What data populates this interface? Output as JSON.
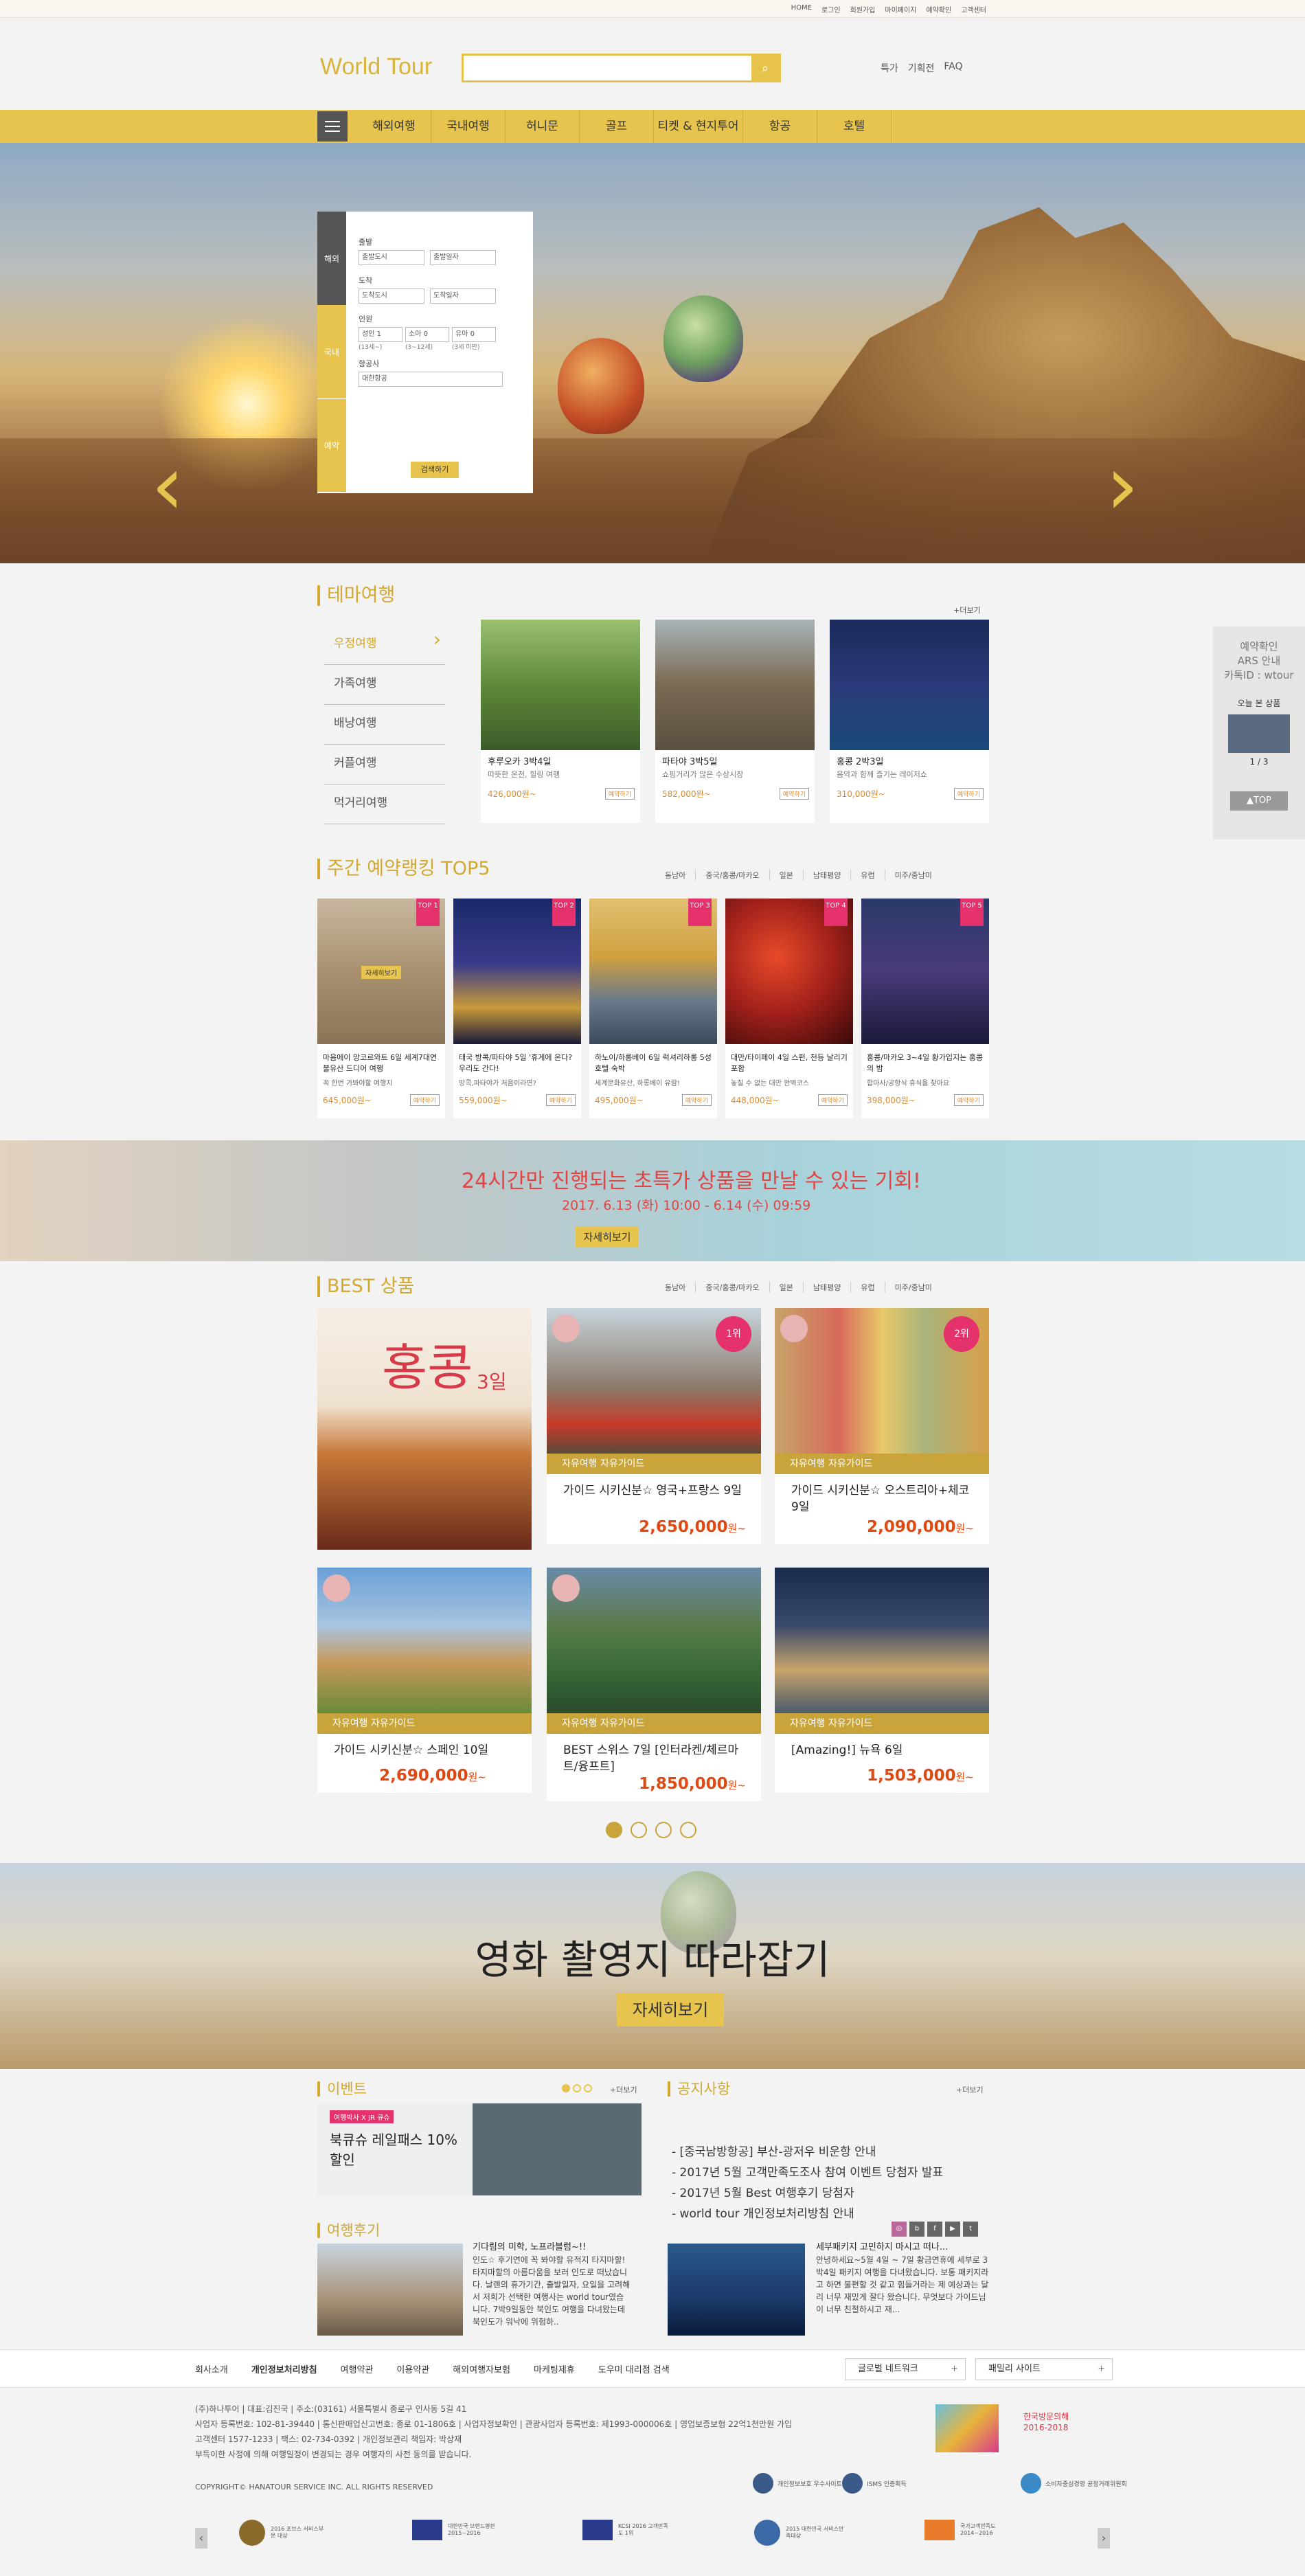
{
  "util_links": [
    "HOME",
    "로그인",
    "회원가입",
    "마이페이지",
    "예약확인",
    "고객센터"
  ],
  "header": {
    "logo": "World Tour",
    "search_placeholder": "",
    "links": [
      "특가",
      "기획전",
      "FAQ"
    ]
  },
  "nav": {
    "items": [
      "해외여행",
      "국내여행",
      "허니문",
      "골프",
      "티켓 & 현지투어",
      "항공",
      "호텔"
    ]
  },
  "booking": {
    "tabs": [
      "해외",
      "국내",
      "예약"
    ],
    "depart_label": "출발",
    "depart_city": "출발도시",
    "depart_date": "출발일자",
    "arrive_label": "도착",
    "arrive_city": "도착도시",
    "arrive_date": "도착일자",
    "people_label": "인원",
    "adult": "성인 1",
    "child": "소아 0",
    "infant": "유아 0",
    "adult_hint": "(13세~)",
    "child_hint": "(3~12세)",
    "infant_hint": "(3세 미만)",
    "airline_label": "항공사",
    "airline": "대한항공",
    "search_button": "검색하기"
  },
  "theme": {
    "title": "테마여행",
    "more": "+더보기",
    "categories": [
      "우정여행",
      "가족여행",
      "배낭여행",
      "커플여행",
      "먹거리여행"
    ],
    "cards": [
      {
        "title": "후루오카 3박4일",
        "sub": "따뜻한 온천, 힐링 여행",
        "price": "426,000원~",
        "btn": "예약하기"
      },
      {
        "title": "파타야 3박5일",
        "sub": "쇼핑거리가 많은 수상시장",
        "price": "582,000원~",
        "btn": "예약하기"
      },
      {
        "title": "홍콩 2박3일",
        "sub": "음악과 함께 즐기는 레이저쇼",
        "price": "310,000원~",
        "btn": "예약하기"
      }
    ]
  },
  "side": {
    "line1": "예약확인",
    "line2": "ARS 안내",
    "line3": "카톡ID : wtour",
    "recent": "오늘 본 상품",
    "page": "1 / 3",
    "top": "▲TOP"
  },
  "ranking": {
    "title": "주간 예약랭킹 TOP5",
    "filters": [
      "동남아",
      "중국/홍콩/마카오",
      "일본",
      "남태평양",
      "유럽",
      "미주/중남미"
    ],
    "cards": [
      {
        "rank": "TOP 1",
        "title": "마음에이 앙코르와트 6일 세계7대연불유산 드디어 여행",
        "sub": "꼭 한번 가봐야할 여행지",
        "price": "645,000원~",
        "btn": "예약하기",
        "overlay": "자세히보기"
      },
      {
        "rank": "TOP 2",
        "title": "태국 방콕/파타야 5일 '휴게에 온다? 우리도 간다!",
        "sub": "방콕,파타야가 처음이라면?",
        "price": "559,000원~",
        "btn": "예약하기"
      },
      {
        "rank": "TOP 3",
        "title": "하노이/하롱베이 6일 럭셔리하롱 5성 호텔 숙박",
        "sub": "세계문화유산, 하롱베이 유람!",
        "price": "495,000원~",
        "btn": "예약하기"
      },
      {
        "rank": "TOP 4",
        "title": "대만/타이페이 4일 스펀, 천등 날리기 포함",
        "sub": "놓칠 수 없는 대만 완벽코스",
        "price": "448,000원~",
        "btn": "예약하기"
      },
      {
        "rank": "TOP 5",
        "title": "홍콩/마카오 3~4일 황가입지는 홍콩의 밤",
        "sub": "합마사/공항식 휴식을 찾아요",
        "price": "398,000원~",
        "btn": "예약하기"
      }
    ]
  },
  "promo": {
    "headline": "24시간만 진행되는 초특가 상품을 만날 수 있는 기회!",
    "dates": "2017. 6.13 (화) 10:00 - 6.14 (수) 09:59",
    "button": "자세히보기"
  },
  "best": {
    "title": "BEST 상품",
    "filters": [
      "동남아",
      "중국/홍콩/마카오",
      "일본",
      "남태평양",
      "유럽",
      "미주/중남미"
    ],
    "hk_title": "홍콩",
    "hk_days": "3일",
    "cards": [
      {
        "tag": "자유여행 자유가이드",
        "name": "가이드 시키신분☆ 영국+프랑스 9일",
        "price": "2,650,000",
        "unit": "원~",
        "num": "1위"
      },
      {
        "tag": "자유여행 자유가이드",
        "name": "가이드 시키신분☆ 오스트리아+체코 9일",
        "price": "2,090,000",
        "unit": "원~",
        "num": "2위"
      },
      {
        "tag": "자유여행 자유가이드",
        "name": "가이드 시키신분☆ 스페인 10일",
        "price": "2,690,000",
        "unit": "원~"
      },
      {
        "tag": "자유여행 자유가이드",
        "name": "BEST 스위스 7일 [인터라켄/체르마트/융프트]",
        "price": "1,850,000",
        "unit": "원~"
      },
      {
        "tag": "자유여행 자유가이드",
        "name": "[Amazing!] 뉴욕 6일",
        "price": "1,503,000",
        "unit": "원~"
      }
    ]
  },
  "movie": {
    "title": "영화 촬영지 따라잡기",
    "button": "자세히보기"
  },
  "event": {
    "title": "이벤트",
    "more": "+더보기",
    "label": "여행박사 X JR 큐슈",
    "text": "북큐슈 레일패스 10% 할인"
  },
  "notice": {
    "title": "공지사항",
    "more": "+더보기",
    "items": [
      "- [중국남방항공] 부산-광저우 비운항 안내",
      "- 2017년 5월 고객만족도조사 참여 이벤트 당첨자 발표",
      "- 2017년 5월 Best 여행후기 당첨자",
      "- world tour 개인정보처리방침 안내"
    ]
  },
  "review": {
    "title": "여행후기",
    "left": {
      "title": "기다림의 미학, 노프라블럼~!!",
      "body": "인도☆ 후기연에 꼭 봐야할 유적지 타지마할! 타지마할의 아름다움을 보러 인도로 떠났습니다. 날렌의 휴가기간, 출발일자, 요일을 고려해서 저희가 선택한 여행사는 world tour였습니다. 7박9일동안 북인도 여행을 다녀왔는데 북인도가 워낙에 위험하.."
    },
    "right": {
      "title": "세부패키지 고민하지 마시고 떠나...",
      "body": "안녕하세요~5월 4일 ~ 7일 황금연휴에 세부로 3박4일 패키지 여행을 다녀왔습니다. 보통 패키지라고 하면 불편할 것 같고 힘들거라는 제 예상과는 달리 너무 재밌게 잘다 왔습니다. 무엇보다 가이드님이 너무 친절하시고 재..."
    }
  },
  "footer": {
    "nav": [
      "회사소개",
      "개인정보처리방침",
      "여행약관",
      "이용약관",
      "해외여행자보험",
      "마케팅제휴",
      "도우미 대리점 검색"
    ],
    "dd1": "글로벌 네트워크",
    "dd2": "패밀리 사이트",
    "info": [
      "(주)하나투어 | 대표:김진국 | 주소:(03161) 서울특별시 종로구 인사동 5길 41",
      "사업자 등록번호: 102-81-39440 | 통신판매업신고번호: 종로 01-1806호 | 사업자정보확인 | 관광사업자 등록번호: 제1993-000006호 | 영업보증보험 22억1천만원 가입",
      "고객센터 1577-1233 | 팩스: 02-734-0392 | 개인정보관리 책임자: 박상재",
      "부득이한 사정에 의해 여행일정이 변경되는 경우 여행자의 사전 동의를 받습니다."
    ],
    "copyright": "COPYRIGHT© HANATOUR SERVICE INC. ALL RIGHTS RESERVED",
    "certs": [
      "개인정보보호 우수사이트",
      "ISMS 인증획득",
      "소비자중심경영 공정거래위원회"
    ],
    "awards": [
      "2016 포브스 서비스부문 대상",
      "대한민국 브랜드평판 2015~2016",
      "KCSI 2016 고객만족도 1위",
      "2015 대한민국 서비스만족대상",
      "국가고객만족도 2014~2016"
    ],
    "logos": [
      "한국방문의해 2016-2018"
    ]
  }
}
